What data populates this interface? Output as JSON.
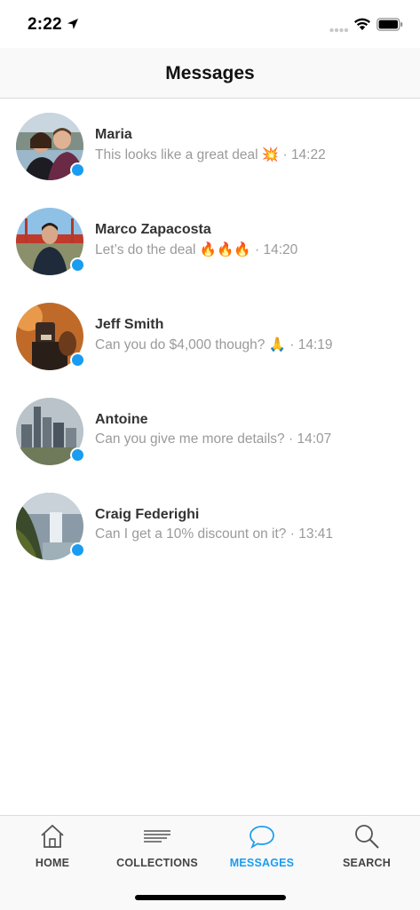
{
  "status_bar": {
    "time": "2:22",
    "icons": [
      "location-arrow-icon",
      "signal-dots-icon",
      "wifi-icon",
      "battery-icon"
    ]
  },
  "header": {
    "title": "Messages"
  },
  "conversations": [
    {
      "name": "Maria",
      "preview": "This looks like a great deal",
      "emoji": "💥",
      "time": "14:22",
      "online": true
    },
    {
      "name": "Marco Zapacosta",
      "preview": "Let’s do the deal",
      "emoji": "🔥🔥🔥",
      "time": "14:20",
      "online": true
    },
    {
      "name": "Jeff Smith",
      "preview": "Can you do $4,000 though?",
      "emoji": "🙏",
      "time": "14:19",
      "online": true
    },
    {
      "name": "Antoine",
      "preview": "Can you give me more details?",
      "emoji": "",
      "time": "14:07",
      "online": true
    },
    {
      "name": "Craig Federighi",
      "preview": "Can I get a 10% discount on it?",
      "emoji": "",
      "time": "13:41",
      "online": true
    }
  ],
  "separator": "·",
  "tab_bar": {
    "tabs": [
      {
        "label": "HOME",
        "icon": "home-icon",
        "active": false
      },
      {
        "label": "COLLECTIONS",
        "icon": "collections-icon",
        "active": false
      },
      {
        "label": "MESSAGES",
        "icon": "chat-bubble-icon",
        "active": true
      },
      {
        "label": "SEARCH",
        "icon": "search-icon",
        "active": false
      }
    ]
  },
  "colors": {
    "accent": "#1a9cf0",
    "online_dot": "#1a9cf0",
    "preview_text": "#9a9a9a",
    "tab_inactive": "#444444"
  }
}
